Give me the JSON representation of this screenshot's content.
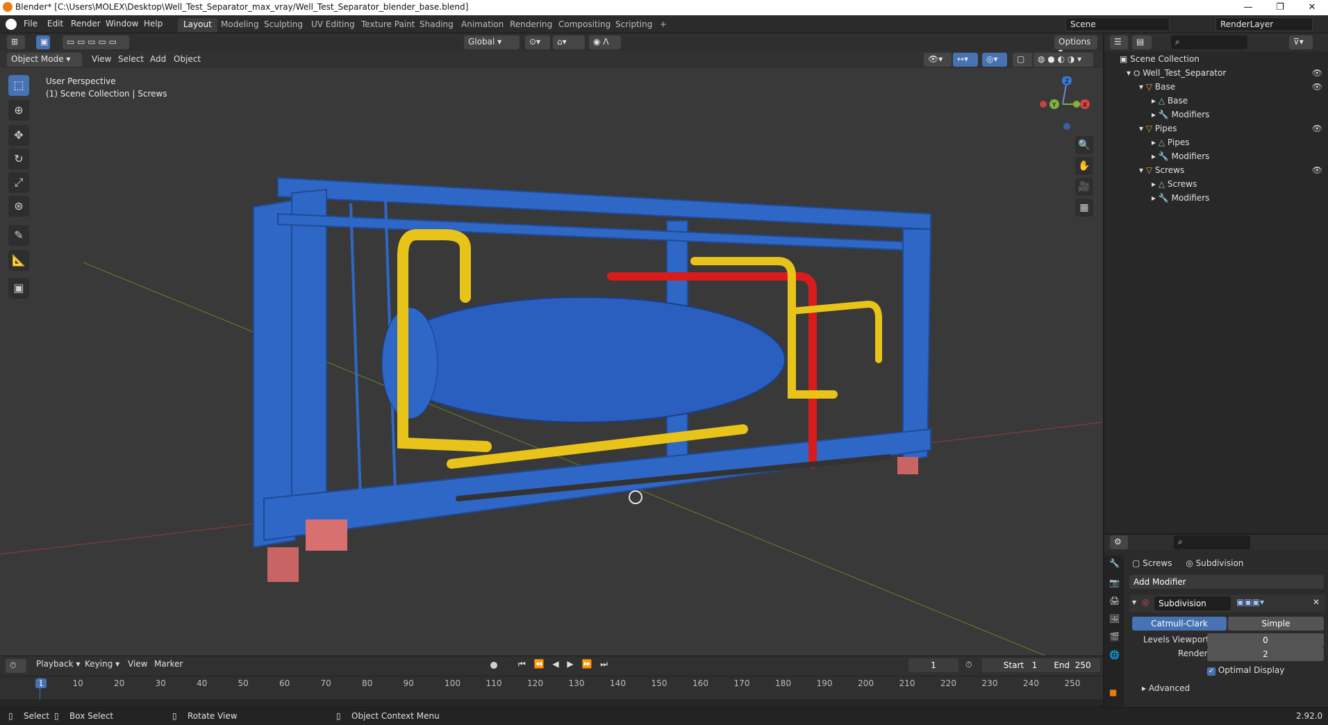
{
  "window": {
    "title": "Blender* [C:\\Users\\MOLEX\\Desktop\\Well_Test_Separator_max_vray/Well_Test_Separator_blender_base.blend]",
    "controls": [
      "—",
      "❐",
      "✕"
    ]
  },
  "menubar": {
    "items": [
      "File",
      "Edit",
      "Render",
      "Window",
      "Help"
    ],
    "workspaces": [
      "Layout",
      "Modeling",
      "Sculpting",
      "UV Editing",
      "Texture Paint",
      "Shading",
      "Animation",
      "Rendering",
      "Compositing",
      "Scripting"
    ],
    "active_workspace": "Layout",
    "add_tab": "+",
    "scene": "Scene",
    "render_layer": "RenderLayer"
  },
  "viewport": {
    "mode": "Object Mode",
    "menu": [
      "View",
      "Select",
      "Add",
      "Object"
    ],
    "orientation": "Global",
    "options": "Options",
    "perspective": "User Perspective",
    "collection_info": "(1) Scene Collection | Screws",
    "gizmo_axes": [
      "Z",
      "Y",
      "X"
    ]
  },
  "outliner": {
    "root": "Scene Collection",
    "rows": [
      {
        "label": "Well_Test_Separator",
        "indent": 1,
        "icon": "collection-icon"
      },
      {
        "label": "Base",
        "indent": 2,
        "icon": "object-icon"
      },
      {
        "label": "Base",
        "indent": 3,
        "icon": "mesh-icon"
      },
      {
        "label": "Modifiers",
        "indent": 3,
        "icon": "wrench-icon"
      },
      {
        "label": "Pipes",
        "indent": 2,
        "icon": "object-icon"
      },
      {
        "label": "Pipes",
        "indent": 3,
        "icon": "mesh-icon"
      },
      {
        "label": "Modifiers",
        "indent": 3,
        "icon": "wrench-icon"
      },
      {
        "label": "Screws",
        "indent": 2,
        "icon": "object-icon"
      },
      {
        "label": "Screws",
        "indent": 3,
        "icon": "mesh-icon"
      },
      {
        "label": "Modifiers",
        "indent": 3,
        "icon": "wrench-icon"
      }
    ]
  },
  "properties": {
    "object": "Screws",
    "modifier_tab": "Subdivision",
    "add_modifier": "Add Modifier",
    "modifier_name": "Subdivision",
    "types": [
      "Catmull-Clark",
      "Simple"
    ],
    "active_type": "Catmull-Clark",
    "levels_viewport_label": "Levels Viewport",
    "levels_viewport": "0",
    "render_label": "Render",
    "render_value": "2",
    "optimal_display": "Optimal Display",
    "advanced": "Advanced"
  },
  "timeline": {
    "menu": [
      "Playback",
      "Keying",
      "View",
      "Marker"
    ],
    "current_frame": "1",
    "start_label": "Start",
    "start": "1",
    "end_label": "End",
    "end": "250",
    "ticks": [
      "1",
      "10",
      "20",
      "30",
      "40",
      "50",
      "60",
      "70",
      "80",
      "90",
      "100",
      "110",
      "120",
      "130",
      "140",
      "150",
      "160",
      "170",
      "180",
      "190",
      "200",
      "210",
      "220",
      "230",
      "240",
      "250"
    ]
  },
  "statusbar": {
    "select": "Select",
    "box_select": "Box Select",
    "rotate": "Rotate View",
    "context": "Object Context Menu",
    "version": "2.92.0"
  },
  "colors": {
    "accent": "#4772b3",
    "frame_blue": "#2f67c6",
    "pipe_yellow": "#e8c41a",
    "pipe_red": "#d81c1c"
  }
}
